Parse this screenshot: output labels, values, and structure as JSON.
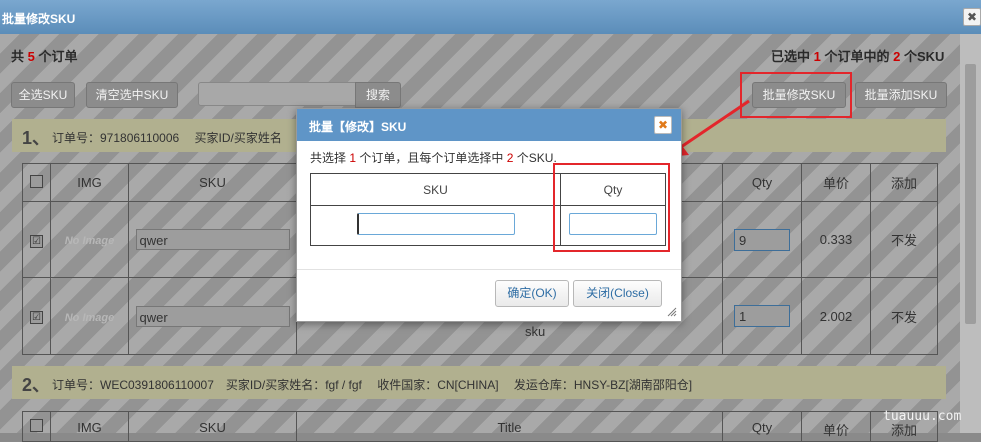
{
  "window": {
    "title": "批量修改SKU",
    "close_glyph": "✖"
  },
  "summary": {
    "total_prefix": "共",
    "total_count": "5",
    "total_suffix": "个订单",
    "sel_prefix": "已选中",
    "sel_orders": "1",
    "sel_mid": "个订单中的",
    "sel_skus": "2",
    "sel_suffix": "个SKU"
  },
  "toolbar": {
    "select_all": "全选SKU",
    "clear_selected": "清空选中SKU",
    "search_value": "",
    "search_button": "搜索",
    "batch_modify": "批量修改SKU",
    "batch_add": "批量添加SKU"
  },
  "order1": {
    "num": "1、",
    "info": "订单号：971806110006　 买家ID/买家姓名"
  },
  "order2": {
    "num": "2、",
    "info": "订单号：WEC0391806110007　买家ID/买家姓名：fgf / fgf　 收件国家：CN[CHINA]　 发运仓库：HNSY-BZ[湖南邵阳仓]"
  },
  "table1": {
    "headers": {
      "img": "IMG",
      "sku": "SKU",
      "qty": "Qty",
      "price": "单价",
      "add": "添加"
    },
    "rows": [
      {
        "checked": "☑",
        "img": "No Image",
        "sku": "qwer",
        "qty": "9",
        "price": "0.333",
        "action": "不发"
      },
      {
        "checked": "☑",
        "img": "No Image",
        "sku": "qwer",
        "qty": "1",
        "price": "2.002",
        "action": "不发"
      }
    ],
    "row2_title_fragment": "sku"
  },
  "table2": {
    "headers": {
      "img": "IMG",
      "sku": "SKU",
      "title": "Title",
      "qty": "Qty",
      "price": "单价",
      "add": "添加"
    }
  },
  "dialog": {
    "title": "批量【修改】SKU",
    "close_glyph": "✖",
    "msg_prefix": "共选择",
    "msg_orders": "1",
    "msg_mid": "个订单，且每个订单选择中",
    "msg_skus": "2",
    "msg_suffix": "个SKU.",
    "col_sku": "SKU",
    "col_qty": "Qty",
    "sku_value": "",
    "qty_value": "",
    "ok_button": "确定(OK)",
    "close_button": "关闭(Close)"
  },
  "watermark": "tuauuu.com",
  "colors": {
    "accent": "#5f95c7",
    "highlight": "#e3262b",
    "count": "#cc0000"
  }
}
